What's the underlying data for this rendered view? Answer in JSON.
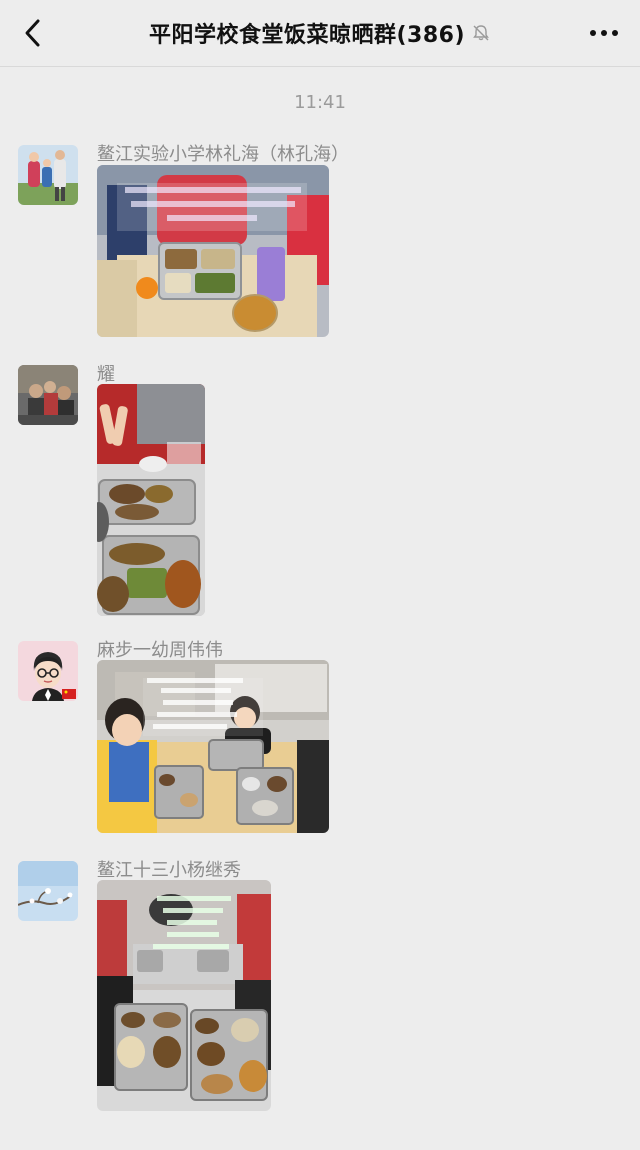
{
  "navbar": {
    "title": "平阳学校食堂饭菜晾晒群(386)",
    "back_icon": "chevron-left-icon",
    "mute_icon": "bell-muted-icon",
    "more_icon": "more-dots-icon"
  },
  "chat": {
    "timestamp": "11:41",
    "messages": [
      {
        "sender": "鳌江实验小学林礼海（林孔海）",
        "type": "image"
      },
      {
        "sender": "耀",
        "type": "image"
      },
      {
        "sender": "麻步一幼周伟伟",
        "type": "image"
      },
      {
        "sender": "鳌江十三小杨继秀",
        "type": "image"
      }
    ]
  },
  "colors": {
    "background": "#ededed",
    "sender_text": "#8c8c8c",
    "timestamp_text": "#9b9b9b"
  }
}
